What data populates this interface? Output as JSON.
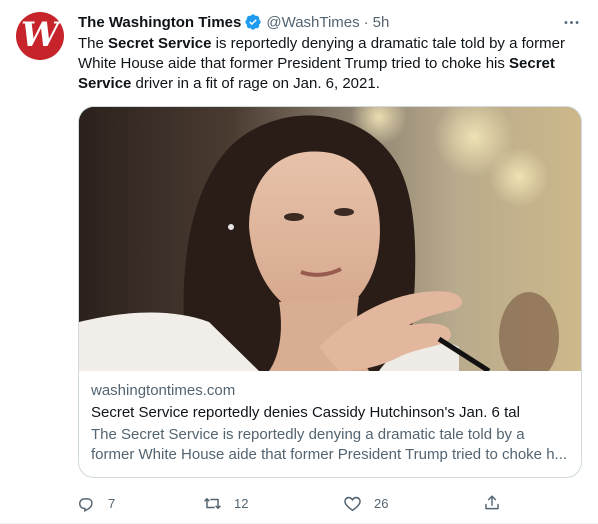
{
  "account": {
    "display_name": "The Washington Times",
    "handle": "@WashTimes",
    "separator": "·",
    "time": "5h",
    "avatar_letter": "W",
    "verified": true
  },
  "tweet": {
    "segments": [
      {
        "text": "The ",
        "bold": false
      },
      {
        "text": "Secret Service",
        "bold": true
      },
      {
        "text": " is reportedly denying a dramatic tale told by a former White House aide that former President Trump tried to choke his ",
        "bold": false
      },
      {
        "text": "Secret Service",
        "bold": true
      },
      {
        "text": " driver in a fit of rage on Jan. 6, 2021.",
        "bold": false
      }
    ]
  },
  "card": {
    "domain": "washingtontimes.com",
    "title": "Secret Service reportedly denies Cassidy Hutchinson's Jan. 6 tal",
    "description": "The Secret Service is reportedly denying a dramatic tale told by a former White House aide that former President Trump tried to choke h..."
  },
  "actions": {
    "replies": "7",
    "retweets": "12",
    "likes": "26"
  },
  "colors": {
    "brand_avatar": "#c6242a",
    "verified": "#1d9bf0",
    "secondary_text": "#536471",
    "primary_text": "#0f1419",
    "border": "#cfd9de"
  },
  "icons": [
    "verified-badge-icon",
    "more-icon",
    "reply-icon",
    "retweet-icon",
    "like-icon",
    "share-icon"
  ]
}
